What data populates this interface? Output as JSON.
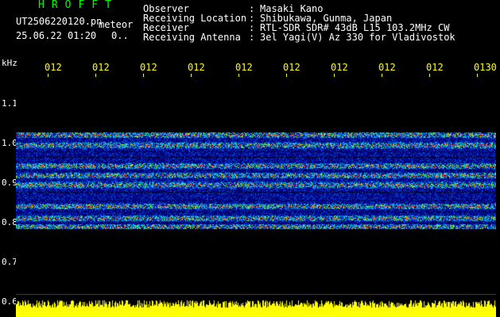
{
  "header": {
    "brand": "HROFFT",
    "brand_color": "#00ff00",
    "filename_part1": "UT2506220120.pn",
    "filename_part2": "meteor",
    "datetime": "25.06.22 01:20",
    "datetime_suffix": "0..",
    "meta": [
      {
        "key": "Observer",
        "sep": ":",
        "value": "Masaki Kano"
      },
      {
        "key": "Receiving Location",
        "sep": ":",
        "value": "Shibukawa, Gunma, Japan"
      },
      {
        "key": "Receiver",
        "sep": ":",
        "value": "RTL-SDR SDR# 43dB L15 103.2MHz CW"
      },
      {
        "key": "Receiving Antenna",
        "sep": ":",
        "value": "3el Yagi(V) Az 330 for Vladivostok"
      }
    ]
  },
  "axis": {
    "unit": "kHz",
    "time_ticks": [
      "012",
      "012",
      "012",
      "012",
      "012",
      "012",
      "012",
      "012",
      "012",
      "0130"
    ],
    "freq_labels": [
      "1.1",
      "1.0",
      "0.9",
      "0.8",
      "0.7",
      "0.6"
    ],
    "tick_color": "#ffff00"
  },
  "spectrum": {
    "background": "#00008b",
    "signal_color": "#ffff00"
  }
}
